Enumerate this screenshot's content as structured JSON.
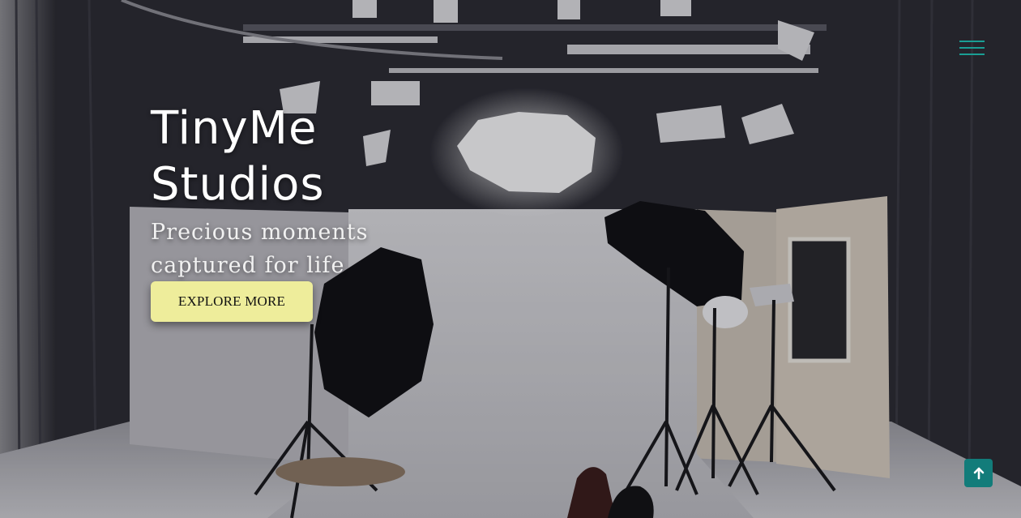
{
  "hero": {
    "title_line1": "TinyMe",
    "title_line2": "Studios",
    "tagline_line1": "Precious moments",
    "tagline_line2": "captured for life",
    "cta_label": "EXPLORE MORE"
  },
  "nav": {
    "menu_icon": "hamburger-menu-icon"
  },
  "back_to_top": {
    "icon": "arrow-up-icon"
  },
  "colors": {
    "menu_accent": "#1a9e94",
    "cta_background": "#eeed9b",
    "back_to_top_background": "#127c7a"
  }
}
